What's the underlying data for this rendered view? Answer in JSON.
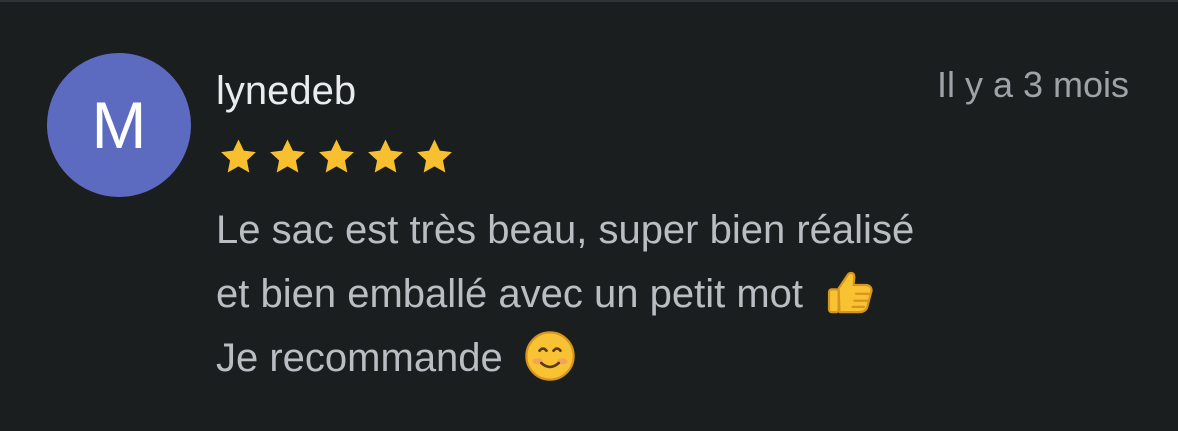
{
  "review": {
    "avatar_initial": "M",
    "author": "lynedeb",
    "timestamp": "Il y a 3 mois",
    "rating": {
      "value": 5,
      "max": 5,
      "star_color": "#f8bf2f"
    },
    "text_lines": [
      "Le sac est très beau, super bien réalisé",
      "et bien emballé avec un petit mot",
      "Je recommande"
    ],
    "emojis": {
      "line_2": "thumbs-up-icon",
      "line_3": "smiling-face-icon"
    }
  },
  "colors": {
    "background": "#1b1e1f",
    "avatar": "#5c6bc0",
    "author_text": "#e9ecee",
    "body_text": "#b9bec2",
    "timestamp_text": "#9ea3a7"
  }
}
